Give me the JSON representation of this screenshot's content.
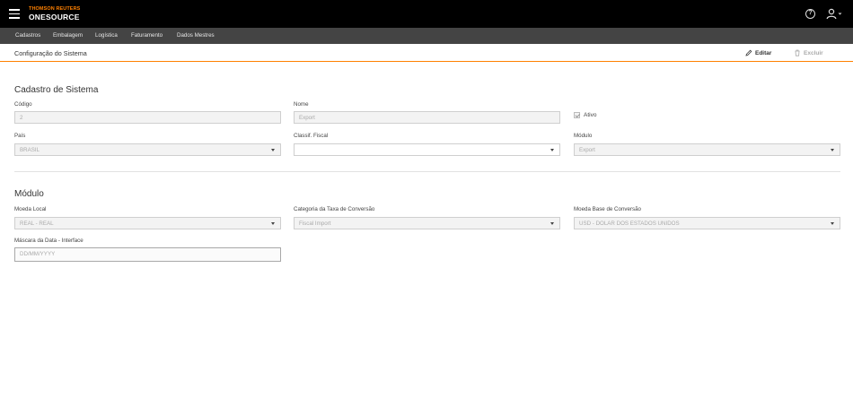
{
  "header": {
    "brand_top": "THOMSON REUTERS",
    "brand_main": "ONESOURCE",
    "help_glyph": "?"
  },
  "nav": {
    "items": [
      {
        "label": "Cadastros"
      },
      {
        "label": "Embalagem"
      },
      {
        "label": "Logística"
      },
      {
        "label": "Faturamento"
      },
      {
        "label": "Dados Mestres"
      }
    ]
  },
  "page": {
    "title": "Configuração do Sistema",
    "edit_label": "Editar",
    "delete_label": "Excluir"
  },
  "cadastro": {
    "section_title": "Cadastro de Sistema",
    "codigo_label": "Código",
    "codigo_value": "2",
    "nome_label": "Nome",
    "nome_value": "Export",
    "ativo_label": "Ativo",
    "pais_label": "País",
    "pais_value": "BRASIL",
    "classif_label": "Classif. Fiscal",
    "classif_value": "",
    "modulo_label": "Módulo",
    "modulo_value": "Export"
  },
  "modulo": {
    "section_title": "Módulo",
    "moeda_local_label": "Moeda Local",
    "moeda_local_value": "REAL - REAL",
    "categoria_label": "Categoria da Taxa de Conversão",
    "categoria_value": "Fiscal Import",
    "moeda_base_label": "Moeda Base de Conversão",
    "moeda_base_value": "USD - DOLAR DOS ESTADOS UNIDOS",
    "mascara_label": "Máscara da Data - Interface",
    "mascara_placeholder": "DD/MM/YYYY"
  },
  "colors": {
    "accent": "#ff8000",
    "topbar": "#000000",
    "navbar": "#444444"
  }
}
